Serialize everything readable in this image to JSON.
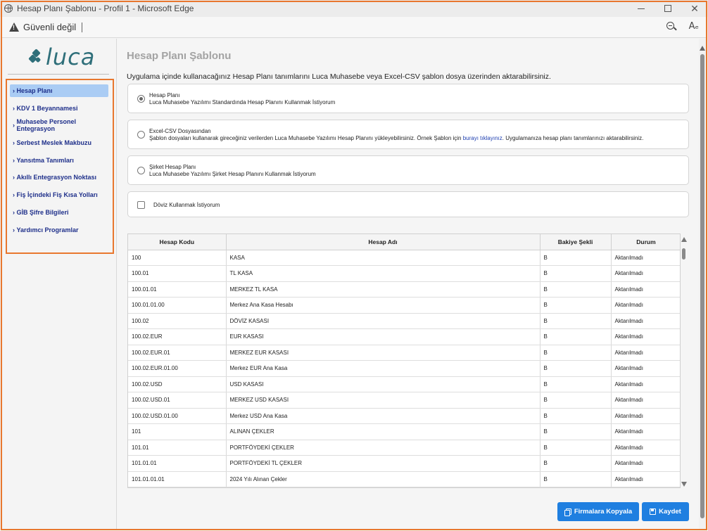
{
  "window": {
    "title": "Hesap Planı Şablonu - Profil 1 - Microsoft Edge",
    "minimize_icon": "minimize-icon",
    "maximize_icon": "maximize-icon",
    "close_label": "✕"
  },
  "addressbar": {
    "security_text": "Güvenli değil",
    "read_aloud_label": "Aₑ"
  },
  "sidebar": {
    "logo_text": "luca",
    "items": [
      {
        "label": "Hesap Planı",
        "active": true
      },
      {
        "label": "KDV 1 Beyannamesi"
      },
      {
        "label": "Muhasebe Personel Entegrasyon"
      },
      {
        "label": "Serbest Meslek Makbuzu"
      },
      {
        "label": "Yansıtma Tanımları"
      },
      {
        "label": "Akıllı Entegrasyon Noktası"
      },
      {
        "label": "Fiş İçindeki Fiş Kısa Yolları"
      },
      {
        "label": "GİB Şifre Bilgileri"
      },
      {
        "label": "Yardımcı Programlar"
      }
    ]
  },
  "main": {
    "title": "Hesap Planı Şablonu",
    "intro": "Uygulama içinde kullanacağınız Hesap Planı tanımlarını Luca Muhasebe veya Excel-CSV şablon dosya üzerinden aktarabilirsiniz.",
    "options": [
      {
        "title": "Hesap Planı",
        "desc": "Luca Muhasebe Yazılımı Standardında Hesap Planını Kullanmak İstiyorum",
        "checked": true
      },
      {
        "title": "Excel-CSV Dosyasından",
        "desc_before": "Şablon dosyaları kullanarak gireceğiniz verilerden Luca Muhasebe Yazılımı Hesap Planını yükleyebilirsiniz. Örnek Şablon için ",
        "desc_link": "burayı tıklayınız",
        "desc_after": ". Uygulamanıza hesap planı tanımlarınızı aktarabilirsiniz.",
        "checked": false
      },
      {
        "title": "Şirket Hesap Planı",
        "desc": "Luca Muhasebe Yazılımı Şirket Hesap Planını Kullanmak İstiyorum",
        "checked": false
      }
    ],
    "currency_checkbox_label": "Döviz Kullanmak İstiyorum",
    "table": {
      "headers": [
        "Hesap Kodu",
        "Hesap Adı",
        "Bakiye Şekli",
        "Durum"
      ],
      "rows": [
        [
          "100",
          "KASA",
          "B",
          "Aktarılmadı"
        ],
        [
          "100.01",
          "TL KASA",
          "B",
          "Aktarılmadı"
        ],
        [
          "100.01.01",
          "MERKEZ TL KASA",
          "B",
          "Aktarılmadı"
        ],
        [
          "100.01.01.00",
          "Merkez Ana Kasa Hesabı",
          "B",
          "Aktarılmadı"
        ],
        [
          "100.02",
          "DÖVİZ KASASI",
          "B",
          "Aktarılmadı"
        ],
        [
          "100.02.EUR",
          "EUR KASASI",
          "B",
          "Aktarılmadı"
        ],
        [
          "100.02.EUR.01",
          "MERKEZ EUR KASASI",
          "B",
          "Aktarılmadı"
        ],
        [
          "100.02.EUR.01.00",
          "Merkez EUR Ana Kasa",
          "B",
          "Aktarılmadı"
        ],
        [
          "100.02.USD",
          "USD KASASI",
          "B",
          "Aktarılmadı"
        ],
        [
          "100.02.USD.01",
          "MERKEZ USD KASASI",
          "B",
          "Aktarılmadı"
        ],
        [
          "100.02.USD.01.00",
          "Merkez USD Ana Kasa",
          "B",
          "Aktarılmadı"
        ],
        [
          "101",
          "ALINAN ÇEKLER",
          "B",
          "Aktarılmadı"
        ],
        [
          "101.01",
          "PORTFÖYDEKİ ÇEKLER",
          "B",
          "Aktarılmadı"
        ],
        [
          "101.01.01",
          "PORTFÖYDEKİ TL ÇEKLER",
          "B",
          "Aktarılmadı"
        ],
        [
          "101.01.01.01",
          "2024 Yılı Alınan Çekler",
          "B",
          "Aktarılmadı"
        ],
        [
          "",
          "",
          "",
          ""
        ]
      ]
    },
    "buttons": {
      "copy_label": "Firmalara Kopyala",
      "save_label": "Kaydet"
    }
  },
  "colors": {
    "accent": "#1f7fe0",
    "highlight_frame": "#e8772e",
    "logo": "#2f6f7a",
    "active_menu": "#aaccf4",
    "menu_text": "#1e2f8a"
  }
}
